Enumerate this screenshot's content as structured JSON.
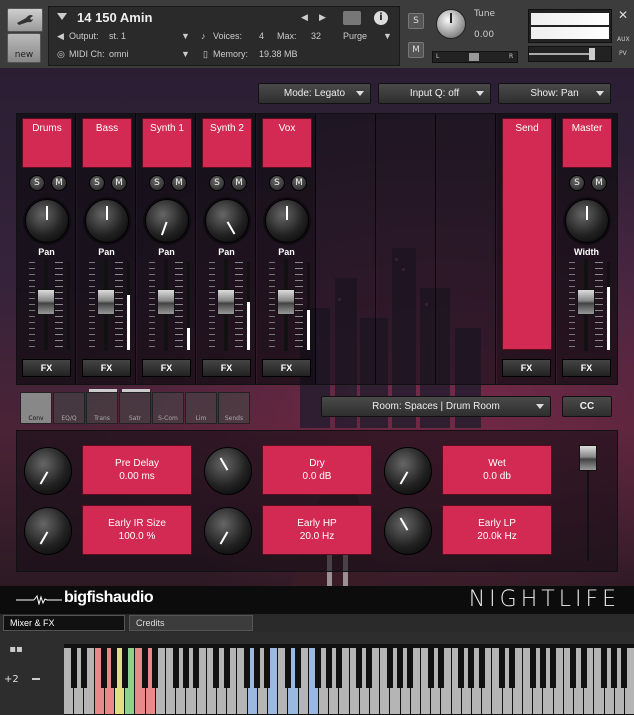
{
  "header": {
    "instrument_name": "14 150 Amin",
    "output_label": "Output:",
    "output_value": "st. 1",
    "voices_label": "Voices:",
    "voices_value": "4",
    "max_label": "Max:",
    "max_value": "32",
    "purge_label": "Purge",
    "midi_label": "MIDI Ch:",
    "midi_value": "omni",
    "memory_label": "Memory:",
    "memory_value": "19.38 MB",
    "new_label": "new",
    "solo": "S",
    "mute": "M",
    "tune_label": "Tune",
    "tune_value": "0.00",
    "l": "L",
    "r": "R",
    "aux": "AUX",
    "pv": "PV"
  },
  "toolbar": {
    "mode": "Mode: Legato",
    "inputq": "Input Q: off",
    "show": "Show: Pan"
  },
  "channels": [
    {
      "name": "Drums",
      "knob": "Pan",
      "angle": 0,
      "fader": 0.55,
      "vu": 0.0
    },
    {
      "name": "Bass",
      "knob": "Pan",
      "angle": 0,
      "fader": 0.55,
      "vu": 0.62
    },
    {
      "name": "Synth 1",
      "knob": "Pan",
      "angle": -160,
      "fader": 0.55,
      "vu": 0.25
    },
    {
      "name": "Synth 2",
      "knob": "Pan",
      "angle": 150,
      "fader": 0.55,
      "vu": 0.55
    },
    {
      "name": "Vox",
      "knob": "Pan",
      "angle": 0,
      "fader": 0.55,
      "vu": 0.45
    }
  ],
  "send": {
    "name": "Send",
    "fx": "FX"
  },
  "master": {
    "name": "Master",
    "knob": "Width",
    "fader": 0.55,
    "vu": 0.72
  },
  "strip_labels": {
    "solo": "S",
    "mute": "M",
    "fx": "FX"
  },
  "fx_tabs": [
    "Conv",
    "EQ/Q",
    "Trans",
    "Satr",
    "S-Com",
    "Lim",
    "Sends"
  ],
  "room": "Room: Spaces | Drum Room",
  "cc": "CC",
  "params": [
    {
      "label": "Pre Delay",
      "value": "0.00 ms"
    },
    {
      "label": "Dry",
      "value": "0.0 dB"
    },
    {
      "label": "Wet",
      "value": "0.0 db"
    },
    {
      "label": "Early IR Size",
      "value": "100.0 %"
    },
    {
      "label": "Early HP",
      "value": "20.0 Hz"
    },
    {
      "label": "Early LP",
      "value": "20.0k Hz"
    }
  ],
  "brand": {
    "logo": "bigfishaudio",
    "product": "NIGHTLIFE"
  },
  "tabs": {
    "mixer": "Mixer & FX",
    "credits": "Credits"
  },
  "keyboard": {
    "octave": "+2"
  },
  "colors": {
    "accent": "#d22a52"
  }
}
